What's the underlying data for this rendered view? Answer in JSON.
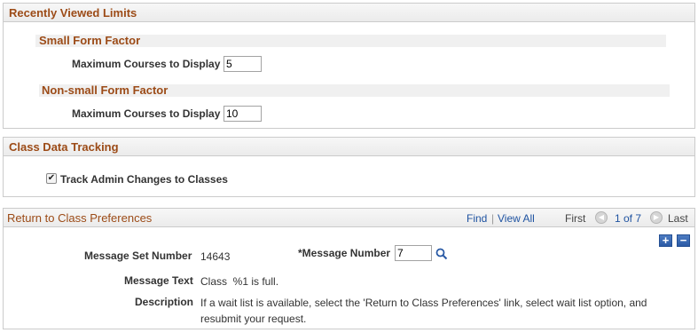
{
  "recently_viewed": {
    "title": "Recently Viewed Limits",
    "small": {
      "heading": "Small Form Factor",
      "label": "Maximum Courses to Display",
      "value": "5"
    },
    "nonsmall": {
      "heading": "Non-small Form Factor",
      "label": "Maximum Courses to Display",
      "value": "10"
    }
  },
  "class_tracking": {
    "title": "Class Data Tracking",
    "checkbox_label": "Track Admin Changes to Classes",
    "checked": true,
    "check_glyph": "✔"
  },
  "return_prefs": {
    "title": "Return to Class Preferences",
    "nav": {
      "find": "Find",
      "sep": "|",
      "view_all": "View All",
      "first": "First",
      "prev_icon": "◀",
      "counter": "1 of 7",
      "next_icon": "▶",
      "last": "Last"
    },
    "add_glyph": "+",
    "remove_glyph": "−",
    "msg_set_label": "Message Set Number",
    "msg_set_value": "14643",
    "msg_num_label": "*Message Number",
    "msg_num_value": "7",
    "msg_text_label": "Message Text",
    "msg_text_value": "Class  %1 is full.",
    "desc_label": "Description",
    "desc_line1": "If a wait list is available, select the 'Return to Class Preferences' link, select wait list option, and",
    "desc_line2": "resubmit your request."
  }
}
